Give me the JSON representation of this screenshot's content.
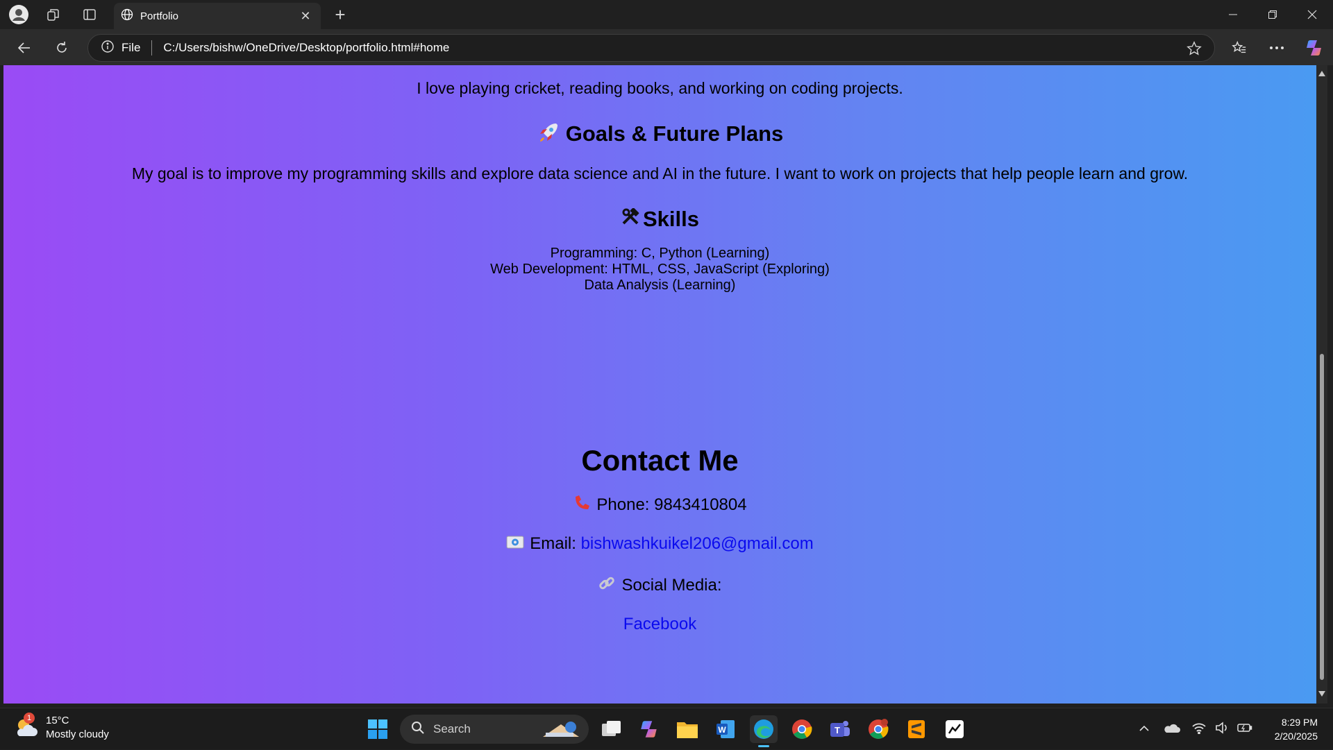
{
  "browser": {
    "tab_title": "Portfolio",
    "address_prefix": "File",
    "url": "C:/Users/bishw/OneDrive/Desktop/portfolio.html#home"
  },
  "page": {
    "hobby_text": "I love playing cricket, reading books, and working on coding projects.",
    "goals_heading": "Goals & Future Plans",
    "goals_text": "My goal is to improve my programming skills and explore data science and AI in the future. I want to work on projects that help people learn and grow.",
    "skills_heading": "Skills",
    "skills": [
      "Programming: C, Python (Learning)",
      "Web Development: HTML, CSS, JavaScript (Exploring)",
      "Data Analysis (Learning)"
    ],
    "contact_heading": "Contact Me",
    "phone_text": "Phone: 9843410804",
    "email_label": "Email:",
    "email": "bishwashkuikel206@gmail.com",
    "social_label": "Social Media:",
    "facebook_label": "Facebook"
  },
  "taskbar": {
    "weather_temp": "15°C",
    "weather_desc": "Mostly cloudy",
    "weather_badge": "1",
    "search_placeholder": "Search",
    "time": "8:29 PM",
    "date": "2/20/2025"
  },
  "colors": {
    "gradient_start": "#9a4bf5",
    "gradient_end": "#4a9af2",
    "link": "#0a0aee"
  }
}
